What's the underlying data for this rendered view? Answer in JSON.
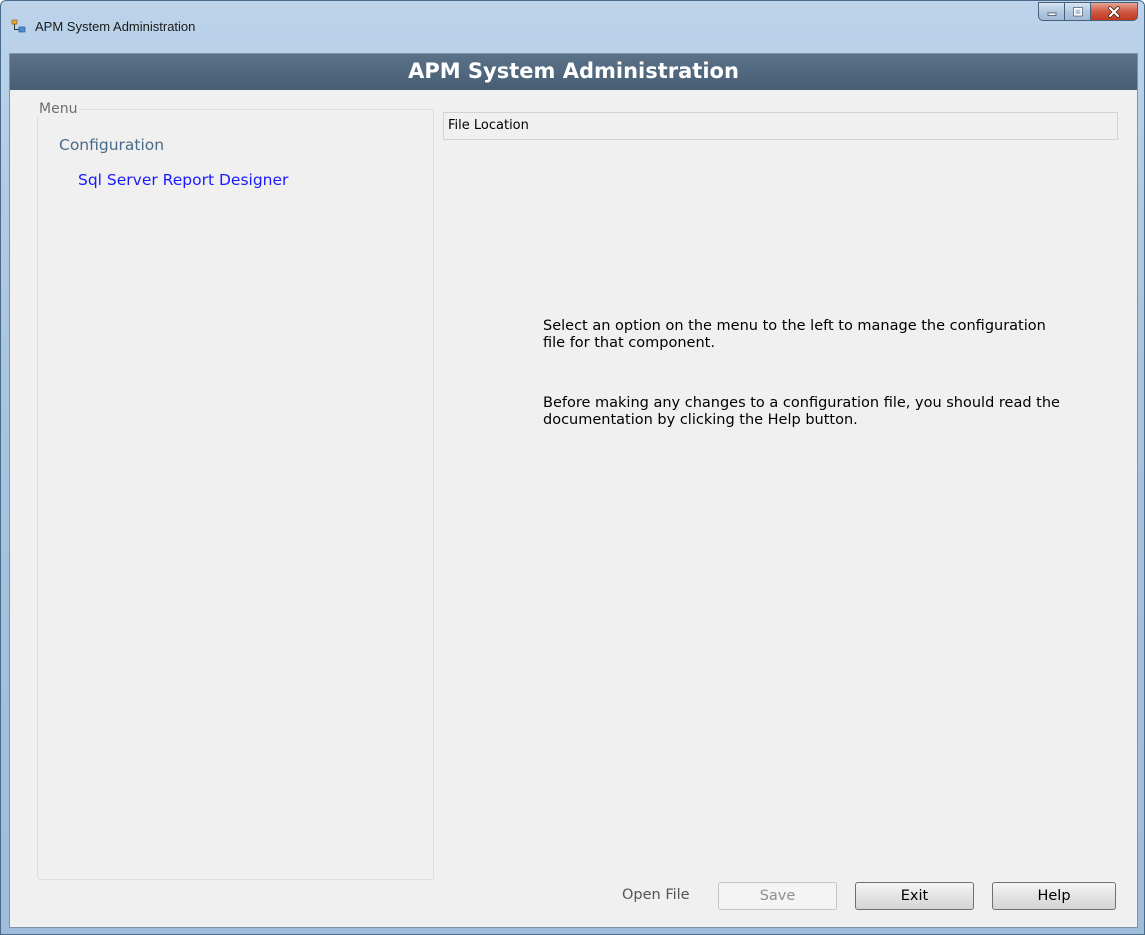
{
  "window": {
    "title": "APM System Administration"
  },
  "header": {
    "title": "APM System Administration"
  },
  "menu": {
    "legend": "Menu",
    "category": "Configuration",
    "items": [
      {
        "label": "Sql Server Report Designer"
      }
    ]
  },
  "main": {
    "file_location_label": "File Location",
    "info_line_1": "Select an option on the menu to the left to manage the configuration file for that component.",
    "info_line_2": "Before making any changes to a configuration file, you should read the documentation by clicking the Help button."
  },
  "footer": {
    "open_file_label": "Open File",
    "save_label": "Save",
    "exit_label": "Exit",
    "help_label": "Help"
  },
  "colors": {
    "header_bg": "#4f667d",
    "menu_link": "#1a1aff",
    "menu_category": "#4a6a8a"
  }
}
